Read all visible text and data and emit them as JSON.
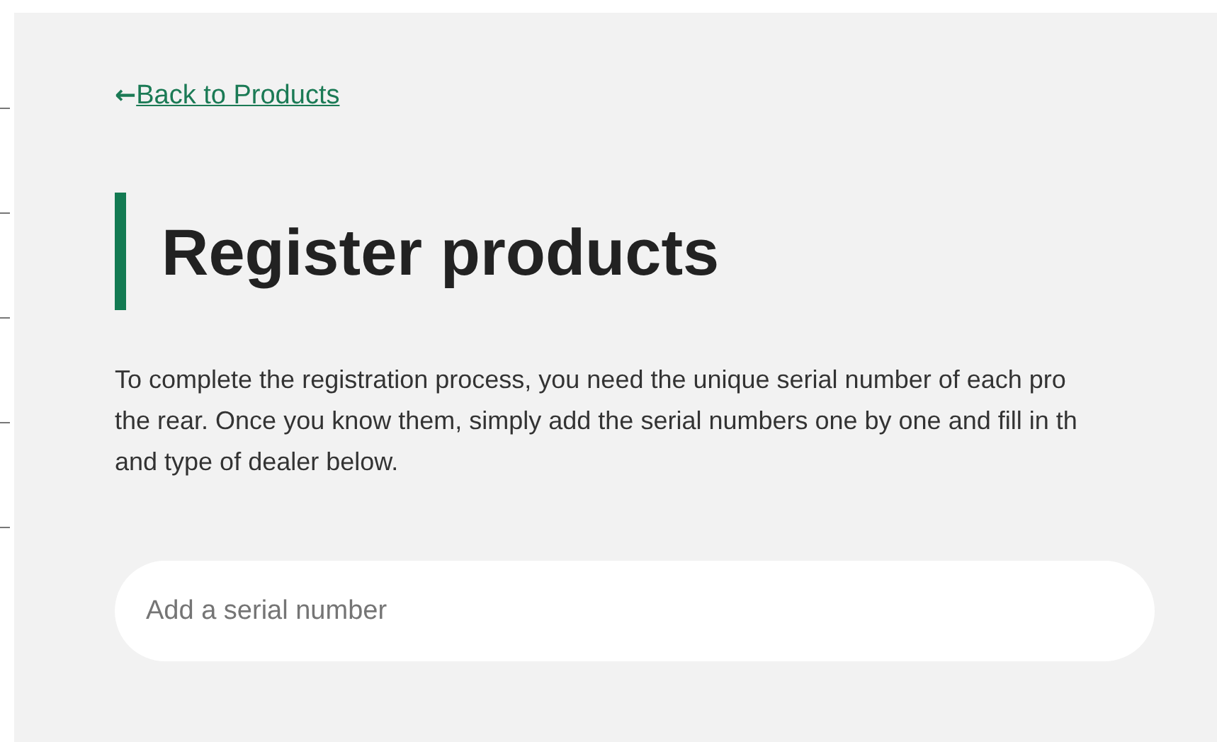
{
  "back_link": {
    "arrow": "←",
    "label": "Back to Products"
  },
  "heading": "Register products",
  "intro_lines": [
    "To complete the registration process, you need the unique serial number of each pro",
    "the rear. Once you know them, simply add the serial numbers one by one and fill in th",
    "and type of dealer below."
  ],
  "serial_field": {
    "placeholder": "Add a serial number"
  }
}
